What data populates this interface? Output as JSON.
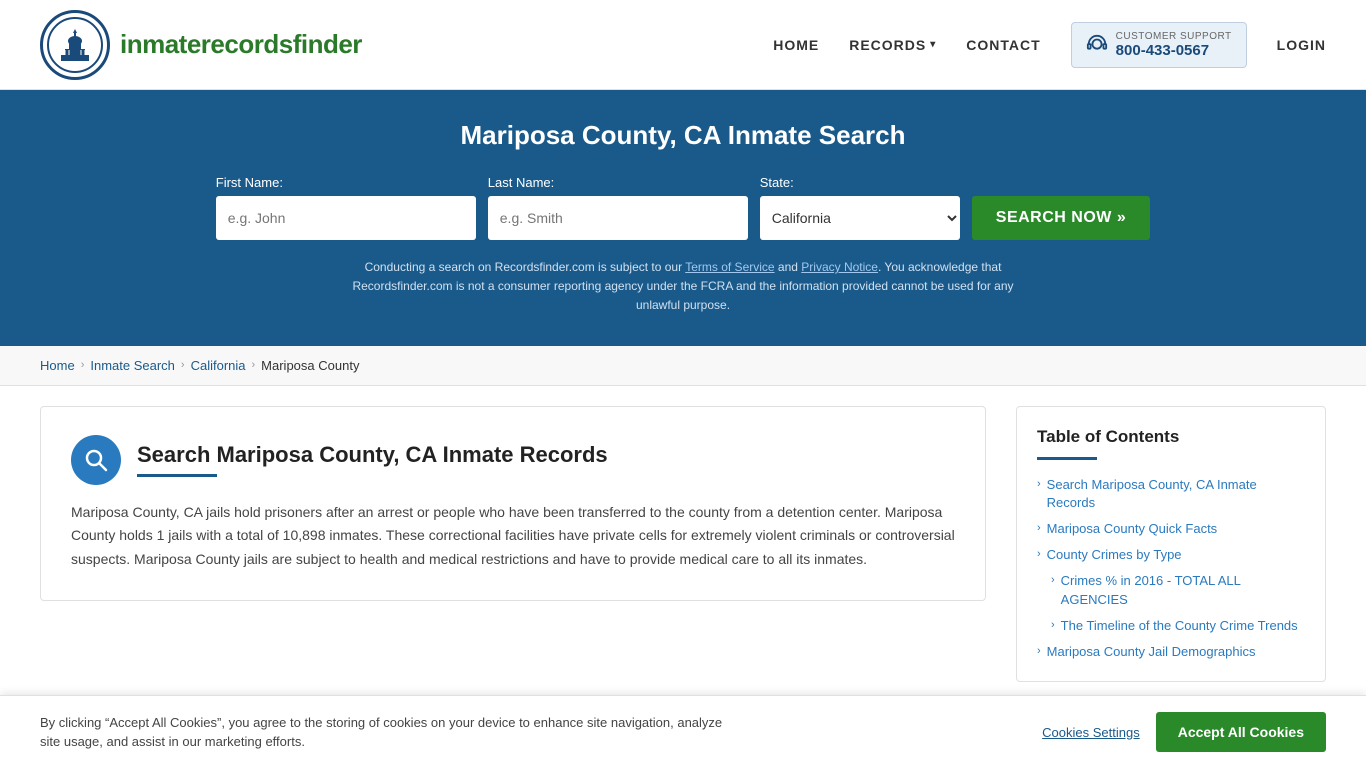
{
  "header": {
    "logo_text_part1": "inmaterecords",
    "logo_text_part2": "finder",
    "nav": {
      "home": "HOME",
      "records": "RECORDS",
      "contact": "CONTACT",
      "login": "LOGIN"
    },
    "support": {
      "label": "CUSTOMER SUPPORT",
      "number": "800-433-0567"
    }
  },
  "hero": {
    "title": "Mariposa County, CA Inmate Search",
    "form": {
      "first_name_label": "First Name:",
      "first_name_placeholder": "e.g. John",
      "last_name_label": "Last Name:",
      "last_name_placeholder": "e.g. Smith",
      "state_label": "State:",
      "state_value": "California",
      "search_button": "SEARCH NOW »"
    },
    "disclaimer": "Conducting a search on Recordsfinder.com is subject to our Terms of Service and Privacy Notice. You acknowledge that Recordsfinder.com is not a consumer reporting agency under the FCRA and the information provided cannot be used for any unlawful purpose."
  },
  "breadcrumb": {
    "items": [
      {
        "label": "Home",
        "link": true
      },
      {
        "label": "Inmate Search",
        "link": true
      },
      {
        "label": "California",
        "link": true
      },
      {
        "label": "Mariposa County",
        "link": false
      }
    ]
  },
  "content": {
    "title": "Search Mariposa County, CA Inmate Records",
    "body": "Mariposa County, CA jails hold prisoners after an arrest or people who have been transferred to the county from a detention center. Mariposa County holds 1 jails with a total of 10,898 inmates. These correctional facilities have private cells for extremely violent criminals or controversial suspects. Mariposa County jails are subject to health and medical restrictions and have to provide medical care to all its inmates."
  },
  "toc": {
    "title": "Table of Contents",
    "items": [
      {
        "label": "Search Mariposa County, CA Inmate Records",
        "sub": false
      },
      {
        "label": "Mariposa County Quick Facts",
        "sub": false
      },
      {
        "label": "County Crimes by Type",
        "sub": false
      },
      {
        "label": "Crimes % in 2016 - TOTAL ALL AGENCIES",
        "sub": true
      },
      {
        "label": "The Timeline of the County Crime Trends",
        "sub": true
      },
      {
        "label": "Mariposa County Jail Demographics",
        "sub": false
      }
    ]
  },
  "cookie_banner": {
    "text": "By clicking “Accept All Cookies”, you agree to the storing of cookies on your device to enhance site navigation, analyze site usage, and assist in our marketing efforts.",
    "settings_label": "Cookies Settings",
    "accept_label": "Accept All Cookies"
  },
  "colors": {
    "brand_blue": "#1a5a8a",
    "brand_green": "#2a8a2a",
    "icon_blue": "#2a7abf"
  }
}
